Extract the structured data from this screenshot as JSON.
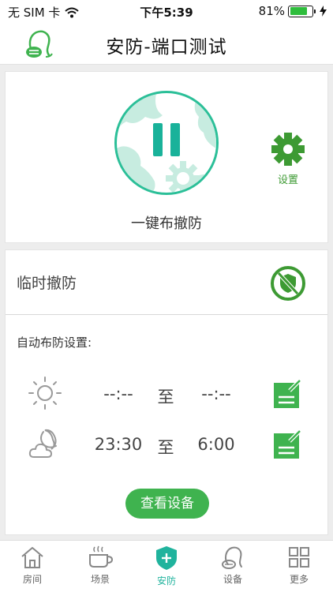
{
  "status_bar": {
    "carrier": "无 SIM 卡",
    "time": "下午5:39",
    "battery_text": "81%",
    "battery_level": 0.81
  },
  "nav": {
    "title": "安防-端口测试"
  },
  "arm_panel": {
    "one_key_label": "一键布撤防",
    "settings_label": "设置"
  },
  "temp_disarm": {
    "label": "临时撤防"
  },
  "auto_arm": {
    "title": "自动布防设置:",
    "rows": [
      {
        "period_icon": "sun-icon",
        "start": "--:--",
        "separator": "至",
        "end": "--:--"
      },
      {
        "period_icon": "moon-cloud-icon",
        "start": "23:30",
        "separator": "至",
        "end": "6:00"
      }
    ]
  },
  "view_devices_label": "查看设备",
  "tabs": [
    {
      "label": "房间",
      "icon": "home-icon",
      "active": false
    },
    {
      "label": "场景",
      "icon": "cup-icon",
      "active": false
    },
    {
      "label": "安防",
      "icon": "shield-plus-icon",
      "active": true
    },
    {
      "label": "设备",
      "icon": "device-icon",
      "active": false
    },
    {
      "label": "更多",
      "icon": "grid-icon",
      "active": false
    }
  ],
  "colors": {
    "accent_teal": "#20b39d",
    "accent_green": "#3fb34f",
    "settings_green": "#3d9a33"
  }
}
